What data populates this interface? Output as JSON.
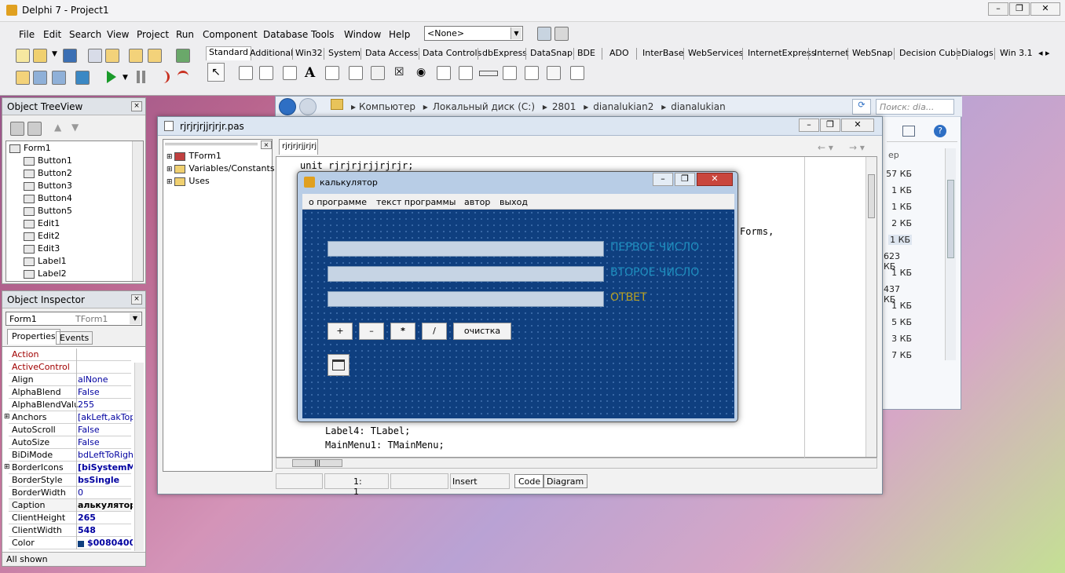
{
  "main": {
    "title": "Delphi 7 - Project1",
    "menu": [
      "File",
      "Edit",
      "Search",
      "View",
      "Project",
      "Run",
      "Component",
      "Database",
      "Tools",
      "Window",
      "Help"
    ],
    "config_combo": "<None>",
    "palette_tabs": [
      "Standard",
      "Additional",
      "Win32",
      "System",
      "Data Access",
      "Data Controls",
      "dbExpress",
      "DataSnap",
      "BDE",
      "ADO",
      "InterBase",
      "WebServices",
      "InternetExpress",
      "Internet",
      "WebSnap",
      "Decision Cube",
      "Dialogs",
      "Win 3.1"
    ]
  },
  "tree_view": {
    "title": "Object TreeView",
    "items": [
      "Form1",
      "Button1",
      "Button2",
      "Button3",
      "Button4",
      "Button5",
      "Edit1",
      "Edit2",
      "Edit3",
      "Label1",
      "Label2"
    ]
  },
  "inspector": {
    "title": "Object Inspector",
    "object": "Form1",
    "object_type": "TForm1",
    "tabs": [
      "Properties",
      "Events"
    ],
    "props": [
      {
        "k": "Action",
        "v": ""
      },
      {
        "k": "ActiveControl",
        "v": ""
      },
      {
        "k": "Align",
        "v": "alNone"
      },
      {
        "k": "AlphaBlend",
        "v": "False"
      },
      {
        "k": "AlphaBlendValu",
        "v": "255"
      },
      {
        "k": "Anchors",
        "v": "[akLeft,akTop"
      },
      {
        "k": "AutoScroll",
        "v": "False"
      },
      {
        "k": "AutoSize",
        "v": "False"
      },
      {
        "k": "BiDiMode",
        "v": "bdLeftToRight"
      },
      {
        "k": "BorderIcons",
        "v": "[biSystemMe"
      },
      {
        "k": "BorderStyle",
        "v": "bsSingle"
      },
      {
        "k": "BorderWidth",
        "v": "0"
      },
      {
        "k": "Caption",
        "v": "алькулятор"
      },
      {
        "k": "ClientHeight",
        "v": "265"
      },
      {
        "k": "ClientWidth",
        "v": "548"
      },
      {
        "k": "Color",
        "v": "$0080400"
      }
    ],
    "status": "All shown"
  },
  "explorer": {
    "breadcrumb": [
      "Компьютер",
      "Локальный диск (C:)",
      "2801",
      "dianalukian2",
      "dianalukian"
    ],
    "search_placeholder": "Поиск: diа...",
    "col_header": "ер",
    "sizes": [
      "57 КБ",
      "1 КБ",
      "1 КБ",
      "2 КБ",
      "1 КБ",
      "623 КБ",
      "1 КБ",
      "437 КБ",
      "1 КБ",
      "5 КБ",
      "3 КБ",
      "7 КБ"
    ]
  },
  "editor": {
    "title": "rjrjrjrjjrjrjr.pas",
    "tab": "rjrjrjrjjrjrjr",
    "tree": [
      "TForm1",
      "Variables/Constants",
      "Uses"
    ],
    "code_top": "unit rjrjrjrjjrjrjr;",
    "code_right": "Forms,",
    "code_lines": [
      "Label4: TLabel;",
      "MainMenu1: TMainMenu;"
    ],
    "status_pos": "1:  1",
    "status_mode": "Insert",
    "bottom_tabs": [
      "Code",
      "Diagram"
    ]
  },
  "calc": {
    "title": "калькулятор",
    "menu": [
      "о программе",
      "текст программы",
      "автор",
      "выход"
    ],
    "labels": [
      "ПЕРВОЕ ЧИСЛО",
      "ВТОРОЕ ЧИСЛО",
      "ОТВЕТ"
    ],
    "buttons": [
      "+",
      "–",
      "*",
      "/",
      "очистка"
    ]
  }
}
